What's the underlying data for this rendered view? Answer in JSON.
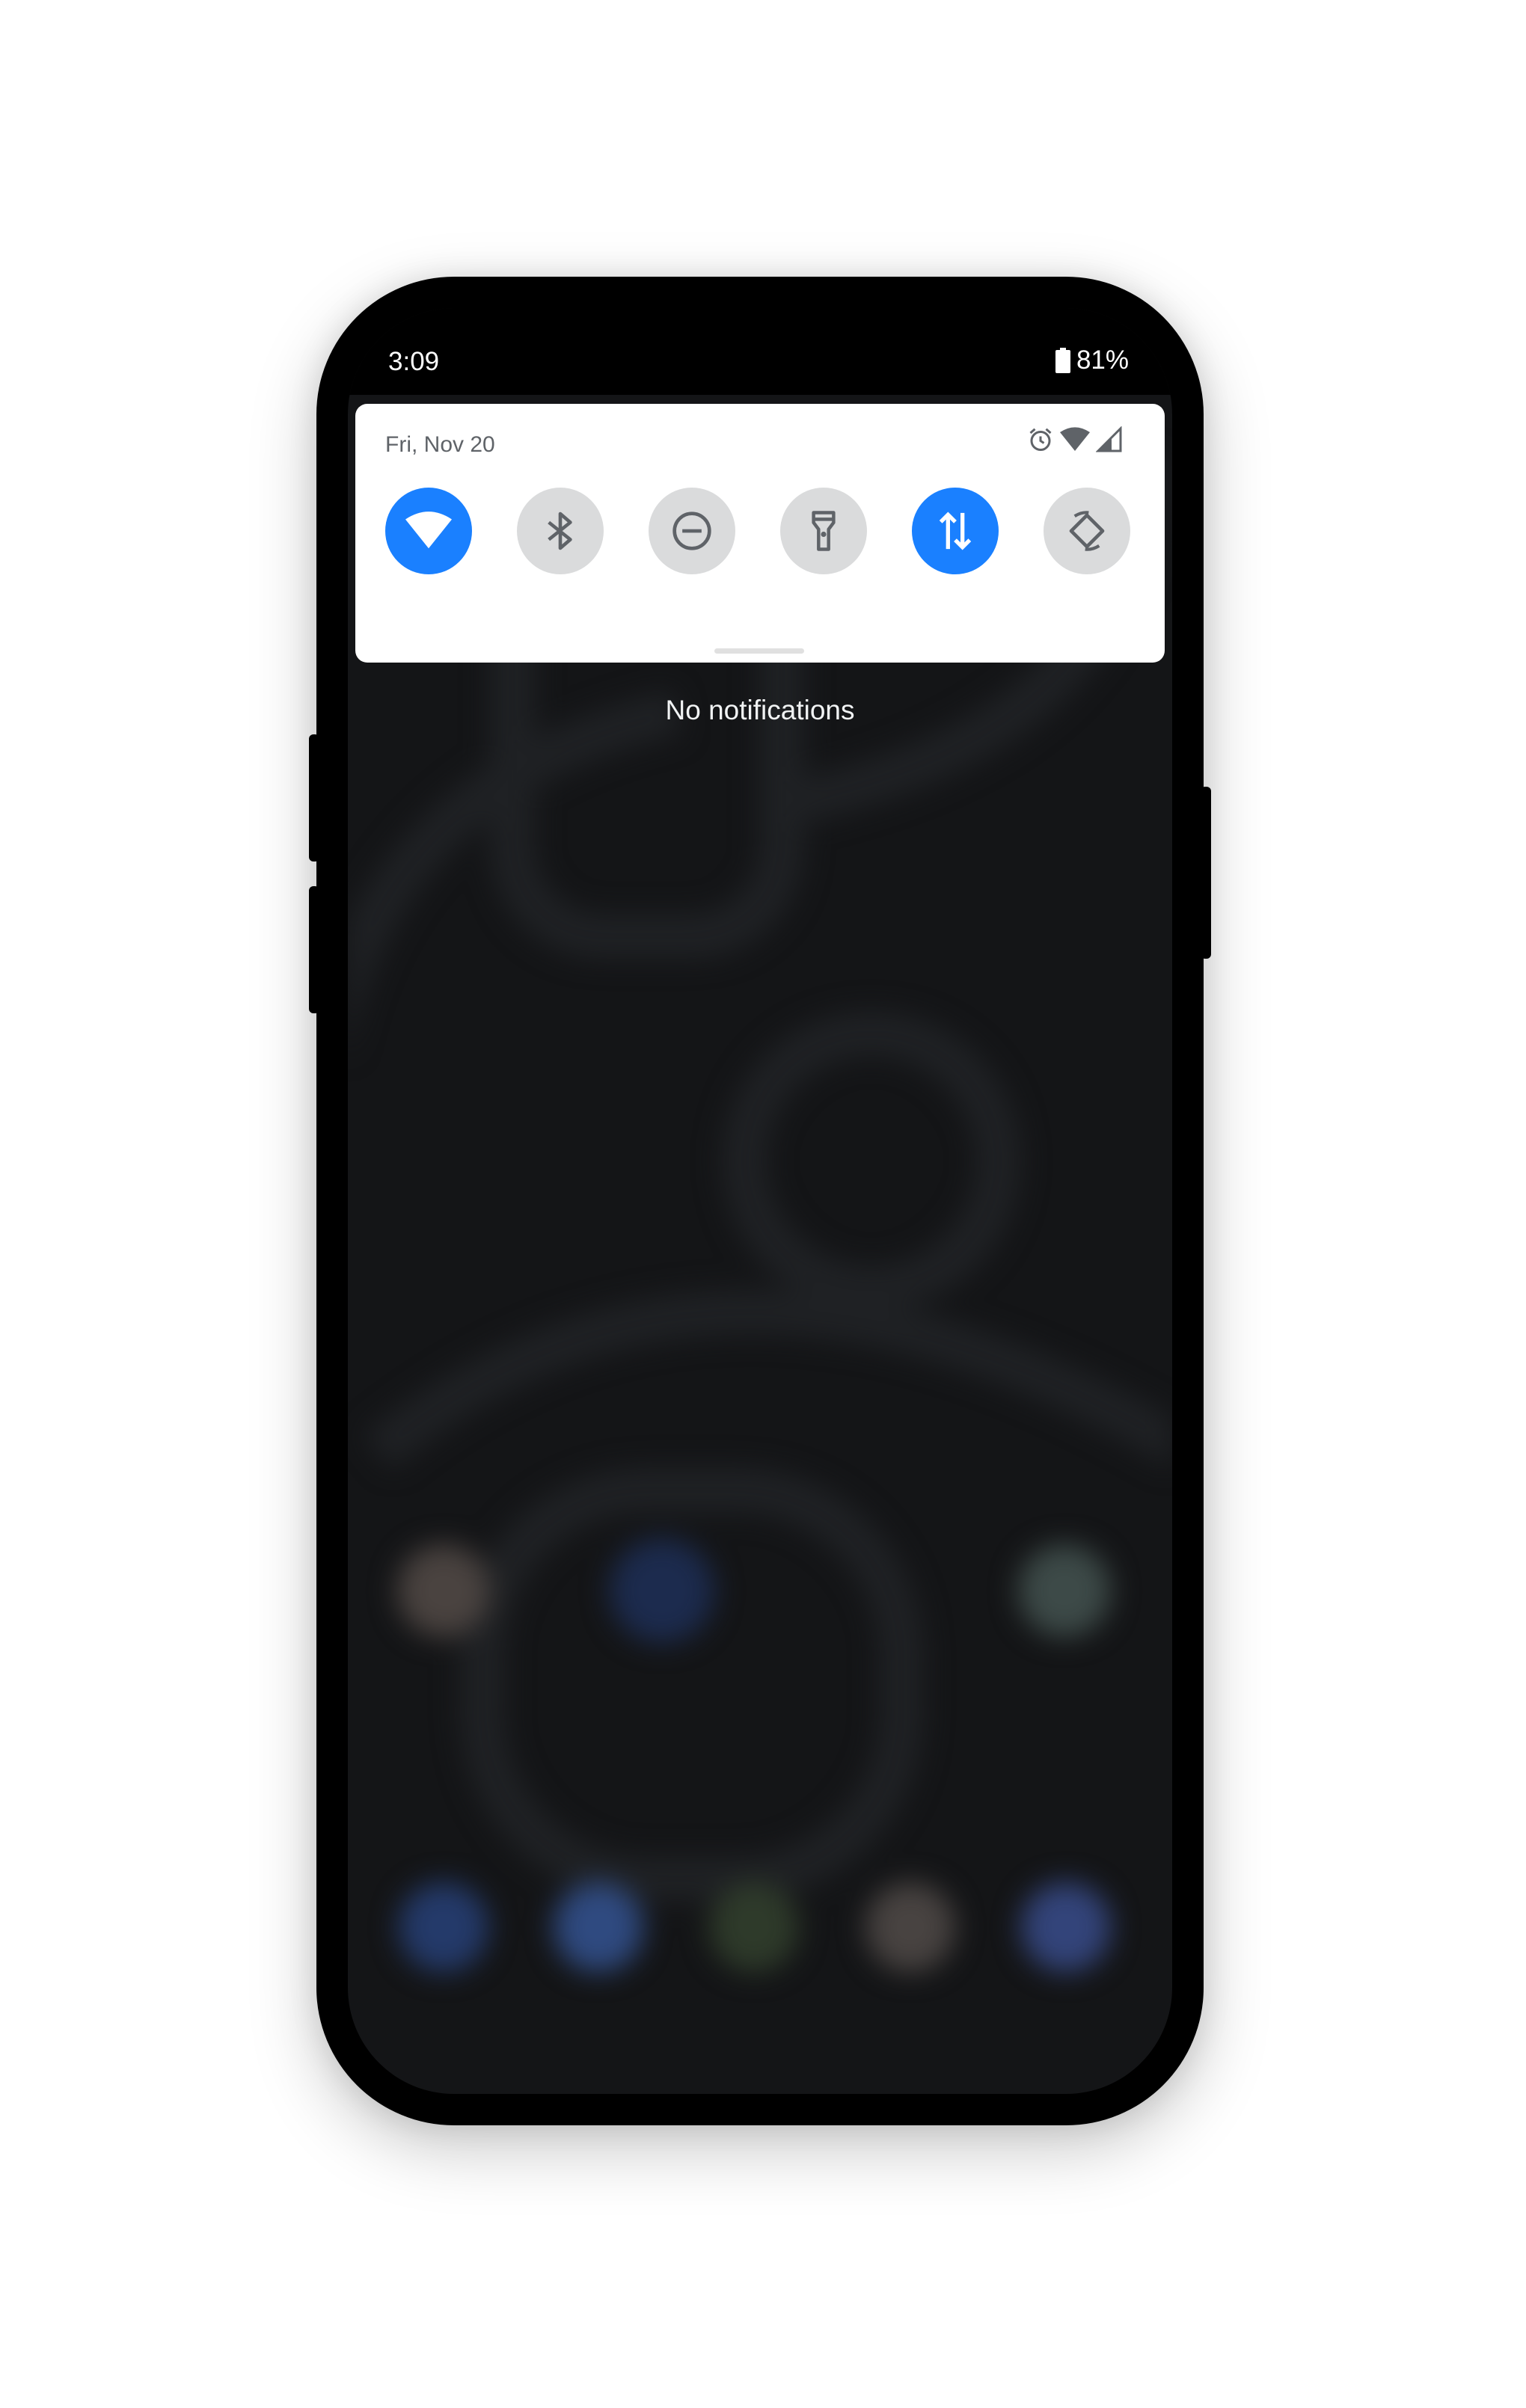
{
  "status_bar": {
    "time": "3:09",
    "battery": "81%"
  },
  "quick_settings": {
    "date": "Fri, Nov 20",
    "status_icons": [
      "alarm-icon",
      "wifi-icon",
      "signal-icon"
    ],
    "tiles": [
      {
        "name": "wifi",
        "icon": "wifi-icon",
        "state": "on"
      },
      {
        "name": "bluetooth",
        "icon": "bluetooth-icon",
        "state": "off"
      },
      {
        "name": "do-not-disturb",
        "icon": "do-not-disturb-icon",
        "state": "off"
      },
      {
        "name": "flashlight",
        "icon": "flashlight-icon",
        "state": "off"
      },
      {
        "name": "mobile-data",
        "icon": "mobile-data-icon",
        "state": "on"
      },
      {
        "name": "auto-rotate",
        "icon": "auto-rotate-icon",
        "state": "off"
      }
    ]
  },
  "notifications": {
    "empty_text": "No notifications"
  },
  "colors": {
    "accent": "#1a80ff",
    "tile_off": "#dadbdc",
    "panel": "#ffffff",
    "wallpaper": "#141517"
  }
}
